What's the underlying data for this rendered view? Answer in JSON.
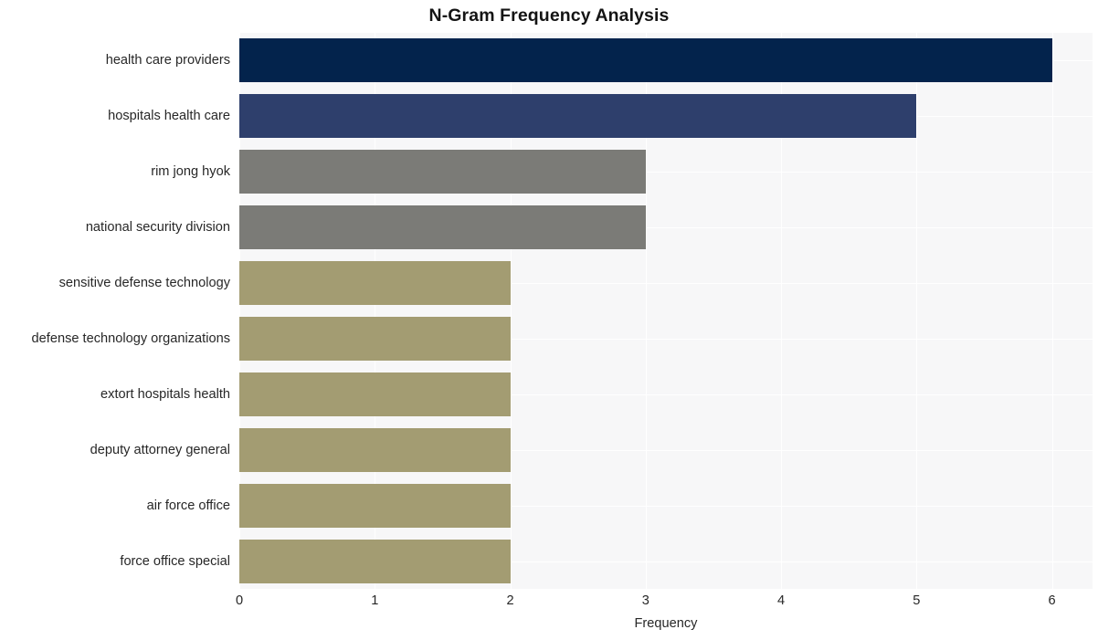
{
  "chart_data": {
    "type": "bar",
    "orientation": "horizontal",
    "title": "N-Gram Frequency Analysis",
    "xlabel": "Frequency",
    "ylabel": "",
    "xlim": [
      0,
      6.3
    ],
    "xticks": [
      "0",
      "1",
      "2",
      "3",
      "4",
      "5",
      "6"
    ],
    "xtick_values": [
      0,
      1,
      2,
      3,
      4,
      5,
      6
    ],
    "grid": true,
    "legend": "none",
    "categories": [
      "health care providers",
      "hospitals health care",
      "rim jong hyok",
      "national security division",
      "sensitive defense technology",
      "defense technology organizations",
      "extort hospitals health",
      "deputy attorney general",
      "air force office",
      "force office special"
    ],
    "values": [
      6,
      5,
      3,
      3,
      2,
      2,
      2,
      2,
      2,
      2
    ],
    "bar_colors": [
      "#03234c",
      "#2e3f6c",
      "#7b7b77",
      "#7b7b77",
      "#a39c72",
      "#a39c72",
      "#a39c72",
      "#a39c72",
      "#a39c72",
      "#a39c72"
    ],
    "plot_background": "#f7f7f8",
    "grid_color": "#ffffff",
    "figure_background": "#ffffff"
  }
}
